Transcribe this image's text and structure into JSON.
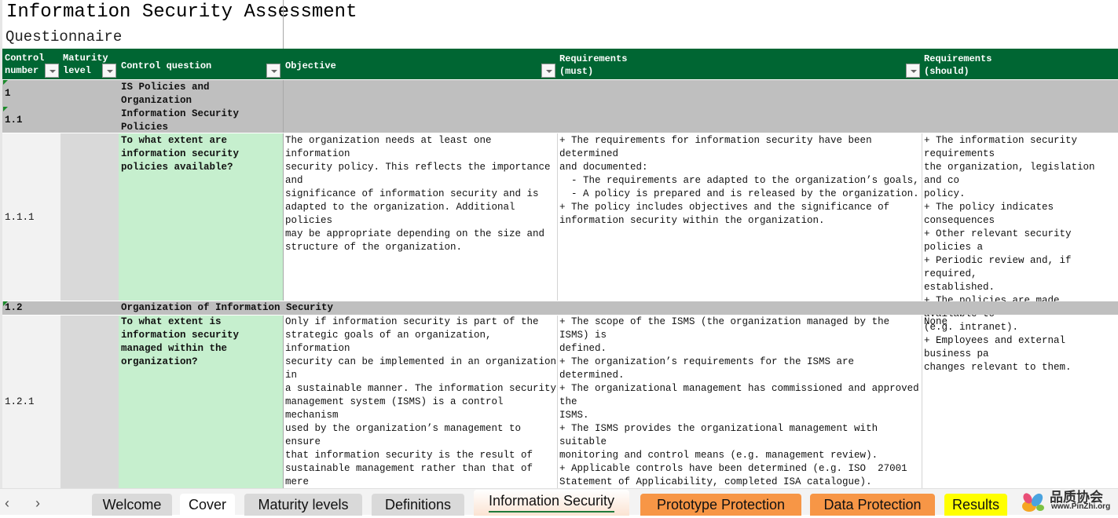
{
  "sheet": {
    "title": "Information Security Assessment",
    "subtitle": "Questionnaire"
  },
  "columns": [
    {
      "label": "Control\nnumber",
      "filter_icon": "sort-filter-icon"
    },
    {
      "label": "Maturity\nlevel",
      "filter_icon": "filter-dropdown-icon"
    },
    {
      "label": "Control question",
      "filter_icon": "filter-dropdown-icon"
    },
    {
      "label": "Objective",
      "filter_icon": "filter-dropdown-icon"
    },
    {
      "label": "Requirements\n(must)",
      "filter_icon": "filter-dropdown-icon"
    },
    {
      "label": "Requirements\n(should)",
      "filter_icon": "filter-dropdown-icon"
    }
  ],
  "rows": [
    {
      "type": "section",
      "number": "1",
      "title": "IS Policies and\nOrganization"
    },
    {
      "type": "section",
      "number": "1.1",
      "title": "Information Security\nPolicies"
    },
    {
      "type": "control",
      "number": "1.1.1",
      "maturity": "",
      "question": "To what extent are\ninformation security\npolicies available?",
      "objective": "The organization needs at least one information\nsecurity policy. This reflects the importance and\nsignificance of information security and is\nadapted to the organization. Additional policies\nmay be appropriate depending on the size and\nstructure of the organization.",
      "must": "+ The requirements for information security have been determined\nand documented:\n  - The requirements are adapted to the organization’s goals,\n  - A policy is prepared and is released by the organization.\n+ The policy includes objectives and the significance of\ninformation security within the organization.",
      "should": "+ The information security requirements\nthe organization, legislation and co\npolicy.\n+ The policy indicates consequences\n+ Other relevant security policies a\n+ Periodic review and, if required,\nestablished.\n+ The policies are made available to\n(e.g. intranet).\n+ Employees and external business pa\nchanges relevant to them."
    },
    {
      "type": "section",
      "number": "1.2",
      "title": "Organization of Information Security"
    },
    {
      "type": "control",
      "number": "1.2.1",
      "maturity": "",
      "question": "To what extent is\ninformation security\nmanaged within the\norganization?",
      "objective": "Only if information security is part of the\nstrategic goals of an organization, information\nsecurity can be implemented in an organization in\na sustainable manner. The information security\nmanagement system (ISMS) is a control mechanism\nused by the organization’s management to ensure\nthat information security is the result of\nsustainable management rather than that of mere\ncoincidence and individual effort.",
      "must": "+ The scope of the ISMS (the organization managed by the ISMS) is\ndefined.\n+ The organization’s requirements for the ISMS are determined.\n+ The organizational management has commissioned and approved the\nISMS.\n+ The ISMS provides the organizational management with suitable\nmonitoring and control means (e.g. management review).\n+ Applicable controls have been determined (e.g. ISO  27001\nStatement of Applicability, completed ISA catalogue).\n+ The effectiveness of the ISMS is regularly reviewed by the\nmanagement.",
      "should": "None"
    }
  ],
  "sheet_tabs": [
    {
      "label": "Welcome",
      "state": "normal",
      "color": "#d9d9d9"
    },
    {
      "label": "Cover",
      "state": "normal",
      "color": "#ffffff"
    },
    {
      "label": "Maturity levels",
      "state": "normal",
      "color": "#d9d9d9"
    },
    {
      "label": "Definitions",
      "state": "normal",
      "color": "#d9d9d9"
    },
    {
      "label": "Information Security",
      "state": "active",
      "color": "#fbe3d2"
    },
    {
      "label": "Prototype Protection",
      "state": "normal",
      "color": "#f79646"
    },
    {
      "label": "Data Protection",
      "state": "normal",
      "color": "#f79646"
    },
    {
      "label": "Results",
      "state": "normal",
      "color": "#ffff00"
    }
  ],
  "nav": {
    "prev": "‹",
    "next": "›"
  },
  "watermark": {
    "text_cn": "品质协会",
    "url": "www.PinZhi.org"
  },
  "colors": {
    "header_green": "#006633",
    "section_gray": "#bfbfbf",
    "question_green": "#c6efce",
    "active_tab_underline": "#1e7a3a"
  }
}
